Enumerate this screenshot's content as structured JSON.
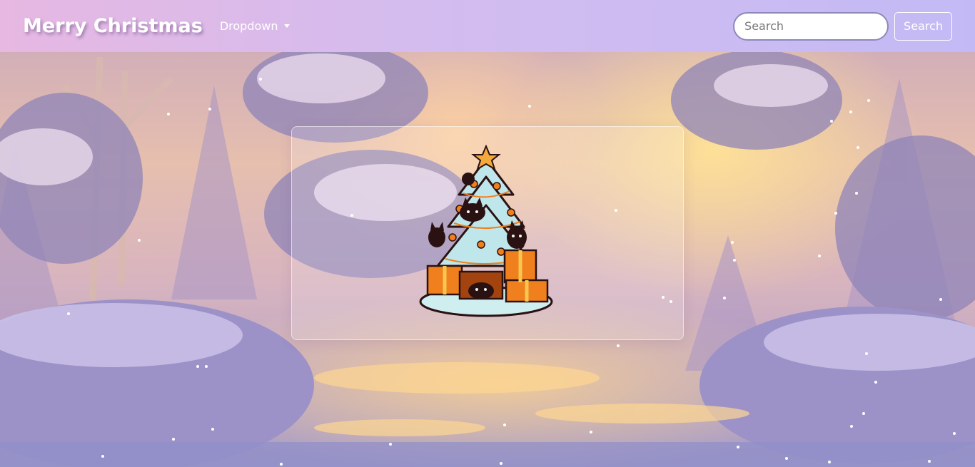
{
  "navbar": {
    "brand": "Merry Christmas",
    "dropdown_label": "Dropdown",
    "search_placeholder": "Search",
    "search_button_label": "Search"
  },
  "colors": {
    "navbar_start": "#e6b8e2",
    "navbar_end": "#c3baf5",
    "tree": "#bfe6ea",
    "gift_orange": "#f07f1d",
    "cat": "#2a1212"
  },
  "icons": {
    "dropdown": "caret-down-icon",
    "illustration": "christmas-tree-cats-illustration"
  }
}
